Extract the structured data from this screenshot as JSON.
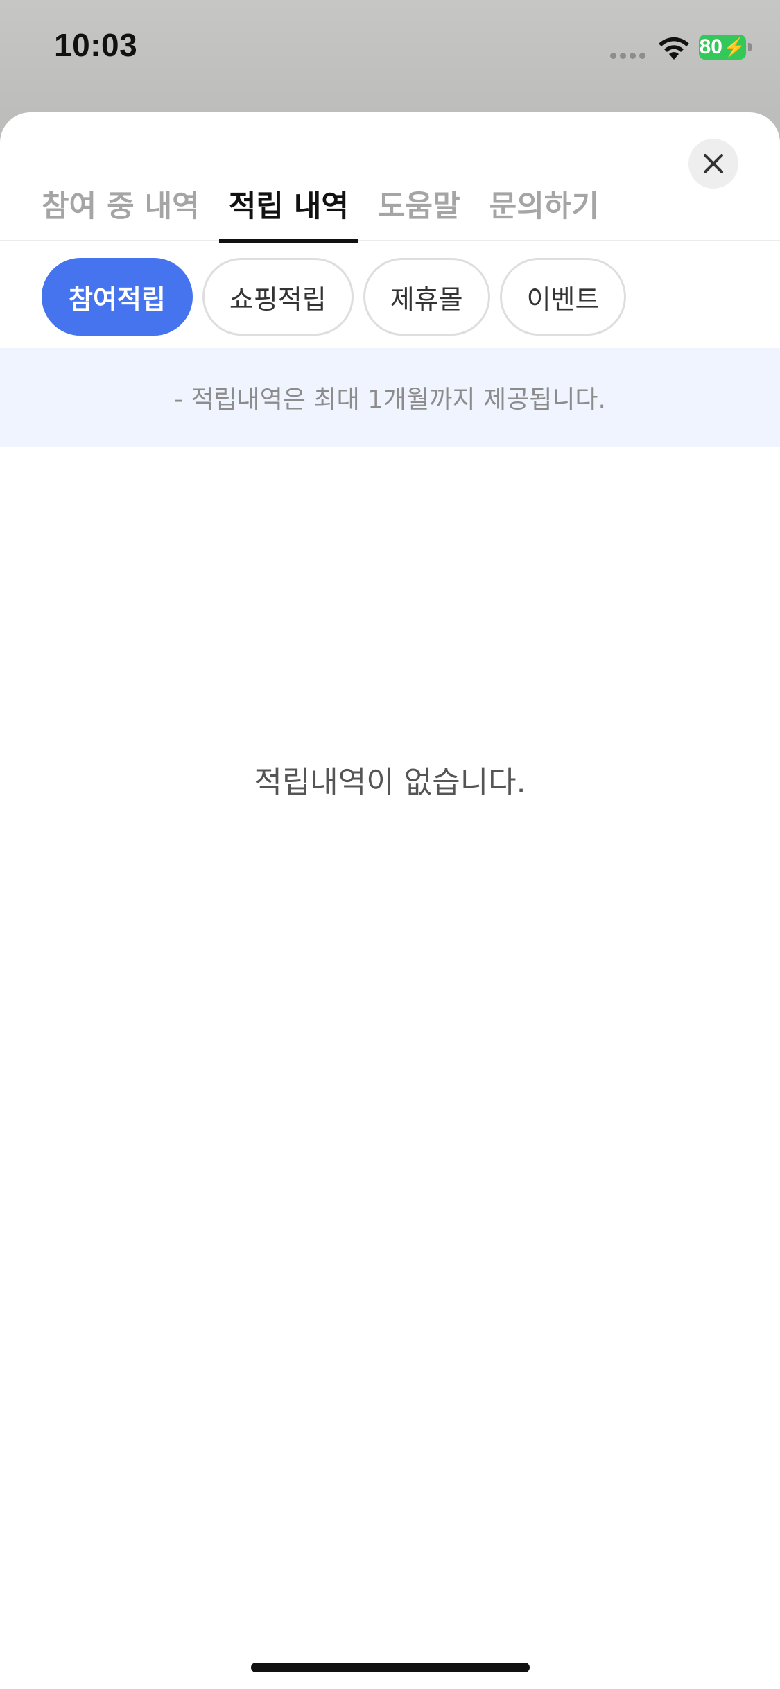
{
  "status_bar": {
    "time": "10:03",
    "battery": "80",
    "battery_color": "#34c759"
  },
  "icons": {
    "wifi": "wifi-icon",
    "battery": "battery-charging-icon",
    "close": "close-icon"
  },
  "tabs": [
    {
      "label": "참여 중 내역",
      "active": false
    },
    {
      "label": "적립 내역",
      "active": true
    },
    {
      "label": "도움말",
      "active": false
    },
    {
      "label": "문의하기",
      "active": false
    }
  ],
  "filters": [
    {
      "label": "참여적립",
      "active": true
    },
    {
      "label": "쇼핑적립",
      "active": false
    },
    {
      "label": "제휴몰",
      "active": false
    },
    {
      "label": "이벤트",
      "active": false
    }
  ],
  "notice": "- 적립내역은 최대 1개월까지 제공됩니다.",
  "empty_message": "적립내역이 없습니다.",
  "colors": {
    "accent": "#4674ee",
    "notice_bg": "#f0f4fe"
  }
}
